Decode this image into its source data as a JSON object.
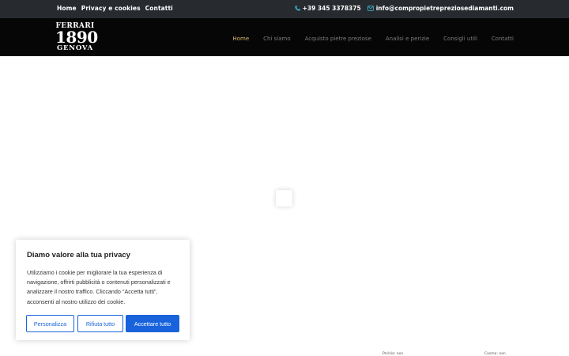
{
  "topbar": {
    "links": [
      "Home",
      "Privacy e cookies",
      "Contatti"
    ],
    "phone": "+39 345 3378375",
    "email": "info@compropietrepreziosediamanti.com",
    "icons": [
      "phone-icon",
      "envelope-icon"
    ],
    "icon_color": "#3ab0c9"
  },
  "header": {
    "logo": {
      "line1": "FERRARI",
      "line2": "1890",
      "line3": "GENOVA"
    },
    "nav": [
      {
        "label": "Home",
        "active": true
      },
      {
        "label": "Chi siamo",
        "active": false
      },
      {
        "label": "Acquisto pietre preziose",
        "active": false
      },
      {
        "label": "Analisi e perizie",
        "active": false
      },
      {
        "label": "Consigli utili",
        "active": false
      },
      {
        "label": "Contatti",
        "active": false
      }
    ],
    "active_color": "#d9b56e"
  },
  "footer_labels": {
    "left": "Perizia: non",
    "right": "Cosma: non"
  },
  "cookie": {
    "title": "Diamo valore alla tua privacy",
    "body": "Utilizziamo i cookie per migliorare la tua esperienza di navigazione, offrirti pubblicità o contenuti personalizzati e analizzare il nostro traffico. Cliccando \"Accetta tutti\", acconsenti al nostro utilizzo dei cookie.",
    "buttons": {
      "customize": "Personalizza",
      "reject": "Rifiuta tutto",
      "accept": "Accettare tutto"
    },
    "accent": "#1863dc"
  }
}
